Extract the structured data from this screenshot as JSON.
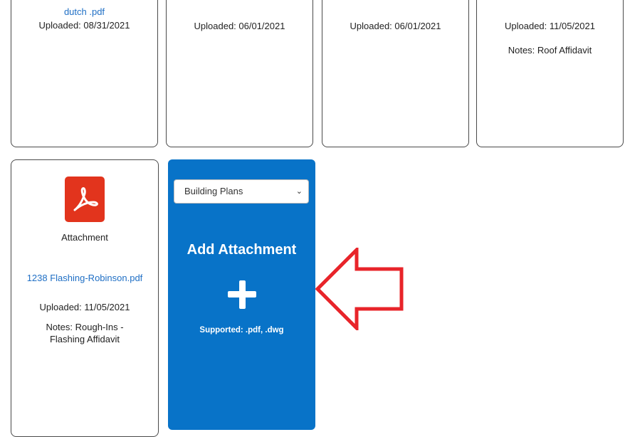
{
  "cards": [
    {
      "filename": "dutch .pdf",
      "uploaded": "Uploaded: 08/31/2021",
      "notes": ""
    },
    {
      "filename": "",
      "uploaded": "Uploaded: 06/01/2021",
      "notes": ""
    },
    {
      "filename": "",
      "uploaded": "Uploaded: 06/01/2021",
      "notes": ""
    },
    {
      "filename": "",
      "uploaded": "Uploaded: 11/05/2021",
      "notes": "Notes: Roof Affidavit"
    }
  ],
  "attachment_card": {
    "icon": "pdf-icon",
    "label": "Attachment",
    "filename": "1238 Flashing-Robinson.pdf",
    "uploaded": "Uploaded: 11/05/2021",
    "notes": "Notes: Rough-Ins - Flashing Affidavit"
  },
  "add_card": {
    "select_value": "Building Plans",
    "title": "Add Attachment",
    "supported": "Supported: .pdf, .dwg",
    "background": "#0873c8"
  },
  "annotation": {
    "icon": "arrow-left-outline-icon",
    "color": "#e8242a"
  }
}
